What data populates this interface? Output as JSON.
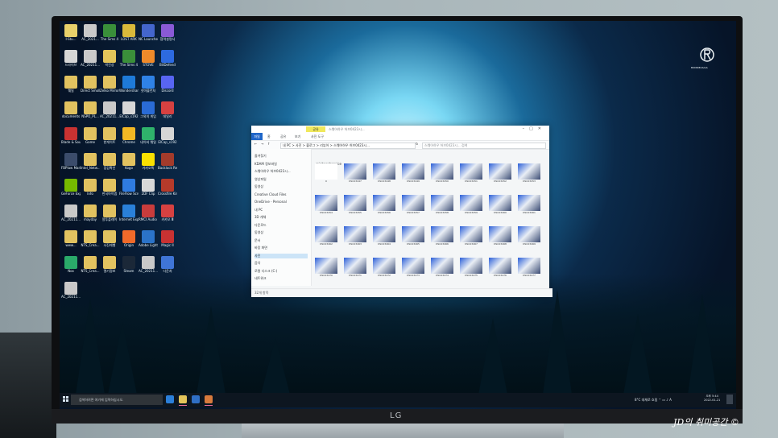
{
  "desktop_icons": [
    {
      "label": "I-Stu...",
      "color": "#e8d06a"
    },
    {
      "label": "AC_2021...",
      "color": "#c9c9c9"
    },
    {
      "label": "The Sims 4",
      "color": "#3a8f3a"
    },
    {
      "label": "LOST ARK",
      "color": "#d9b93a"
    },
    {
      "label": "NC Launcher 2",
      "color": "#4466cc"
    },
    {
      "label": "협력설명서",
      "color": "#8a5ad6"
    },
    {
      "label": "드라이브",
      "color": "#d6d6d6"
    },
    {
      "label": "AC_20211...",
      "color": "#c9c9c9"
    },
    {
      "label": "박진성",
      "color": "#e3c45a"
    },
    {
      "label": "The Sims 4",
      "color": "#3a8f3a"
    },
    {
      "label": "STOVE",
      "color": "#ef8a2a"
    },
    {
      "label": "BitDefend",
      "color": "#2d6ae0"
    },
    {
      "label": "웨일",
      "color": "#e1c260"
    },
    {
      "label": "Direct Smoll...",
      "color": "#e1c260"
    },
    {
      "label": "Zelko Mirror...",
      "color": "#e1c260"
    },
    {
      "label": "Wondershare Filmora X",
      "color": "#1e7ad8"
    },
    {
      "label": "넷마블런처",
      "color": "#2f82e6"
    },
    {
      "label": "Discord",
      "color": "#5865f2"
    },
    {
      "label": "documents",
      "color": "#e1c260"
    },
    {
      "label": "NSPO_PL...",
      "color": "#e1c260"
    },
    {
      "label": "AC_20211...",
      "color": "#c9c9c9"
    },
    {
      "label": "ElCap_s192",
      "color": "#d6d6d6"
    },
    {
      "label": "그외의 게임",
      "color": "#2a6bd6"
    },
    {
      "label": "데일리",
      "color": "#d64141"
    },
    {
      "label": "Blade & Soul",
      "color": "#c83232"
    },
    {
      "label": "Game",
      "color": "#e1c260"
    },
    {
      "label": "한게이트",
      "color": "#e1c260"
    },
    {
      "label": "Chrome",
      "color": "#f2b824"
    },
    {
      "label": "네이버 웨일",
      "color": "#2fb36b"
    },
    {
      "label": "ElCap_s192",
      "color": "#d6d6d6"
    },
    {
      "label": "FBPlaw Marianna",
      "color": "#3b4c6b"
    },
    {
      "label": "Intel_Netw...",
      "color": "#e1c260"
    },
    {
      "label": "점검확인",
      "color": "#e1c260"
    },
    {
      "label": "Kogo",
      "color": "#e1c260"
    },
    {
      "label": "카카오톡",
      "color": "#f9e000"
    },
    {
      "label": "Backlock Remastered",
      "color": "#a33b2b"
    },
    {
      "label": "GeForce Experience",
      "color": "#76b900"
    },
    {
      "label": "Info",
      "color": "#e1c260"
    },
    {
      "label": "한국아이엠",
      "color": "#e1c260"
    },
    {
      "label": "FileFlow Screen...",
      "color": "#2f7be0"
    },
    {
      "label": "2DF Clip",
      "color": "#d8d8d8"
    },
    {
      "label": "Crossfire Kings 3",
      "color": "#b53a2a"
    },
    {
      "label": "AC_20211...",
      "color": "#c9c9c9"
    },
    {
      "label": "mayday",
      "color": "#e1c260"
    },
    {
      "label": "알투플레이",
      "color": "#e1c260"
    },
    {
      "label": "Internet Explorer",
      "color": "#2a80d8"
    },
    {
      "label": "RMCI Audio 7.1",
      "color": "#c83c3c"
    },
    {
      "label": "카카오 Ⅲ",
      "color": "#d64141"
    },
    {
      "label": "www...",
      "color": "#e1c260"
    },
    {
      "label": "NTS_Crea...",
      "color": "#e1c260"
    },
    {
      "label": "사진레벨",
      "color": "#e1c260"
    },
    {
      "label": "Origin",
      "color": "#f06a2a"
    },
    {
      "label": "Adobe Lightroo...",
      "color": "#2b73c8"
    },
    {
      "label": "Magic II",
      "color": "#c83232"
    },
    {
      "label": "Nox",
      "color": "#2aaa6a"
    },
    {
      "label": "NTS_Crea...",
      "color": "#e1c260"
    },
    {
      "label": "열기정보",
      "color": "#e1c260"
    },
    {
      "label": "Steam",
      "color": "#1b2838"
    },
    {
      "label": "AC_20211...",
      "color": "#c9c9c9"
    },
    {
      "label": "다운처",
      "color": "#3f75d6"
    },
    {
      "label": "AC_20211...",
      "color": "#c9c9c9"
    }
  ],
  "explorer": {
    "tab_label": "공유",
    "title": "스웨어하우 허브0423시...",
    "ribbon_tabs": [
      "파일",
      "홈",
      "공유",
      "보기",
      "사진 도구"
    ],
    "address": "내 PC > 사진 > 블로그 > 리뷰어 > 스웨어하우 허브0423시...",
    "search_placeholder": "스웨어하우 허브0423시... 검색",
    "section_header": "@iobandservice",
    "nav_items": [
      "즐겨찾기",
      "KDAM 정보파일",
      "스웨어하우 허브0423시...",
      "영상파일",
      "동영상",
      "Creative Cloud Files",
      "OneDrive - Personal",
      "내 PC",
      "3D 개체",
      "다운로드",
      "동영상",
      "문서",
      "바탕 화면",
      "사진",
      "음악",
      "로컬 디스크 (C:)",
      "네트워크"
    ],
    "selected_nav": "사진",
    "thumbnails": [
      "0",
      "DSC03447",
      "DSC03448",
      "DSC03449",
      "DSC03450",
      "DSC03451",
      "DSC03452",
      "DSC03453",
      "DSC03454",
      "DSC03455",
      "DSC03456",
      "DSC03457",
      "DSC03458",
      "DSC03459",
      "DSC03460",
      "DSC03461",
      "DSC03462",
      "DSC03463",
      "DSC03464",
      "DSC03465",
      "DSC03466",
      "DSC03467",
      "DSC03468",
      "DSC03469",
      "DSC03470",
      "DSC03471",
      "DSC03472",
      "DSC03473",
      "DSC03474",
      "DSC03475",
      "DSC03476",
      "DSC03477"
    ],
    "status": "32개 항목"
  },
  "taskbar": {
    "search_placeholder": "검색하려면 여기에 입력하십시오.",
    "tray_text": "8°C 대체로 흐림",
    "ime": "A",
    "clock_time": "오후 5:44",
    "clock_date": "2022-01-21"
  },
  "brand": {
    "text": "BONNIEASAIA"
  },
  "monitor_logo": "LG",
  "watermark": "JD의 취미공간 ©"
}
